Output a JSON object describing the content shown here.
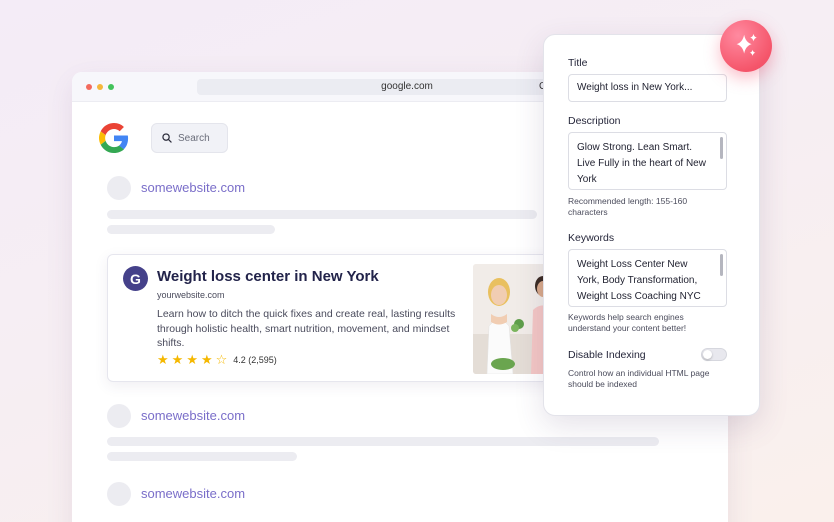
{
  "browser": {
    "url": "google.com",
    "url_suffix": "G",
    "search_placeholder": "Search"
  },
  "results": [
    {
      "site": "somewebsite.com"
    },
    {
      "site": "somewebsite.com"
    },
    {
      "site": "somewebsite.com"
    }
  ],
  "featured": {
    "badge_letter": "G",
    "title": "Weight loss center in New York",
    "url": "yourwebsite.com",
    "description": "Learn how to ditch the quick fixes and create real, lasting results through holistic health, smart nutrition, movement, and mindset shifts.",
    "rating": 4.2,
    "rating_text": "4.2 (2,595)",
    "stars_filled": 4,
    "stars_total": 5
  },
  "panel": {
    "title_label": "Title",
    "title_value": "Weight loss in New York...",
    "description_label": "Description",
    "description_value": "Glow Strong. Lean Smart. Live Fully in the heart of New York",
    "description_hint": "Recommended length: 155-160 characters",
    "keywords_label": "Keywords",
    "keywords_value": "Weight Loss Center New York, Body Transformation, Weight Loss Coaching NYC",
    "keywords_hint": "Keywords help search engines understand your content better!",
    "indexing_label": "Disable Indexing",
    "indexing_enabled": false,
    "indexing_hint": "Control how an individual HTML page should be indexed"
  },
  "icons": {
    "search": "search-icon",
    "sparkle": "sparkle-icon",
    "google": "google-logo",
    "star": "star-icon"
  },
  "colors": {
    "accent": "#f5566b",
    "link": "#7a6ec9",
    "badge": "#45418a",
    "star": "#f5b800"
  }
}
